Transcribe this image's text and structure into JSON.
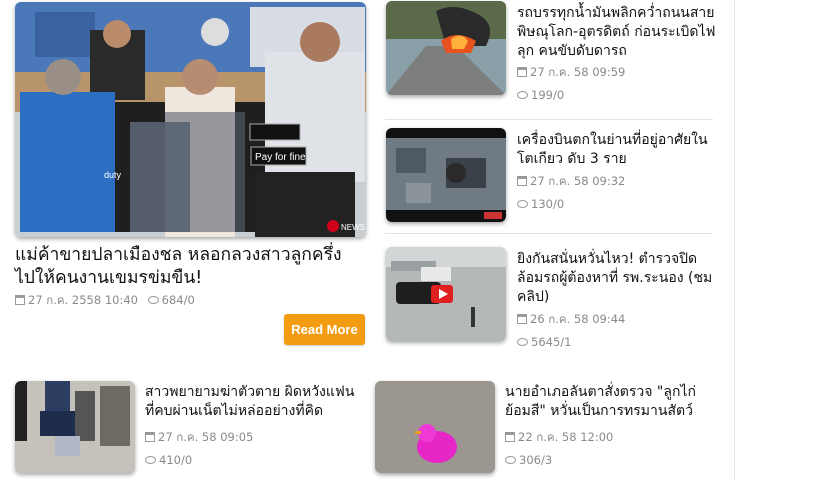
{
  "featured": {
    "title": "แม่ค้าขายปลาเมืองชล หลอกลวงสาวลูกครึ่ง ไปให้คนงานเขมรข่มขืน!",
    "date": "27 ก.ค. 2558 10:40",
    "comments": "684/0",
    "read_more": "Read More",
    "image_signs": {
      "duty": "duty",
      "pay": "Pay for fine",
      "logo": "NEWS"
    }
  },
  "side_news": [
    {
      "title": "รถบรรทุกน้ำมันพลิกคว่ำถนนสายพิษณุโลก-อุตรดิตถ์ ก่อนระเบิดไฟลุก คนขับดับดารถ",
      "date": "27 ก.ค. 58 09:59",
      "comments": "199/0"
    },
    {
      "title": "เครื่องบินตกในย่านที่อยู่อาศัยในโตเกียว ดับ 3 ราย",
      "date": "27 ก.ค. 58 09:32",
      "comments": "130/0"
    },
    {
      "title": "ยิงกันสนั่นหวั่นไหว! ตำรวจปิดล้อมรถผู้ต้องหาที่ รพ.ระนอง (ชมคลิป)",
      "date": "26 ก.ค. 58 09:44",
      "comments": "5645/1"
    }
  ],
  "bottom_news": [
    {
      "title": "สาวพยายามฆ่าตัวตาย ผิดหวังแฟนที่คบผ่านเน็ตไม่หล่ออย่างที่คิด",
      "date": "27 ก.ค. 58 09:05",
      "comments": "410/0"
    },
    {
      "title": "นายอำเภอลันตาสั่งตรวจ \"ลูกไก่ย้อมสี\" หวั่นเป็นการทรมานสัตว์",
      "date": "22 ก.ค. 58 12:00",
      "comments": "306/3"
    }
  ],
  "colors": {
    "accent": "#f39c12",
    "meta": "#8a8a8a",
    "title": "#111111"
  }
}
